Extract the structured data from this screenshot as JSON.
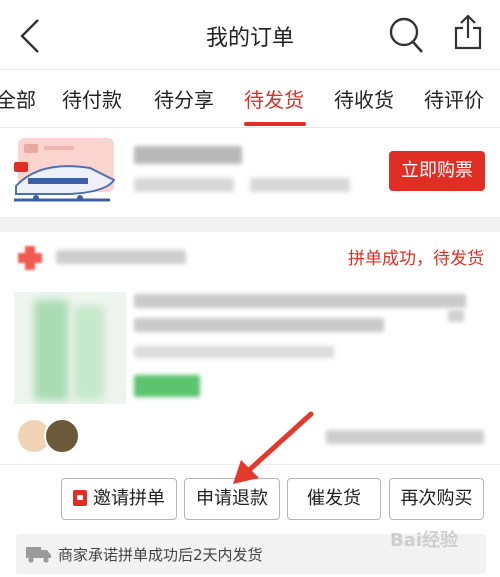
{
  "header": {
    "title": "我的订单",
    "back_icon": "chevron-left-icon",
    "search_icon": "search-icon",
    "share_icon": "share-icon"
  },
  "tabs": [
    {
      "label": "全部"
    },
    {
      "label": "待付款"
    },
    {
      "label": "待分享"
    },
    {
      "label": "待发货",
      "active": true
    },
    {
      "label": "待收货"
    },
    {
      "label": "待评价"
    }
  ],
  "promo": {
    "button_label": "立即购票"
  },
  "order": {
    "status": "拼单成功，待发货",
    "buttons": {
      "invite": "邀请拼单",
      "refund": "申请退款",
      "remind": "催发货",
      "rebuy": "再次购买"
    },
    "notice": "商家承诺拼单成功后2天内发货"
  },
  "watermark": "Bai经验",
  "colors": {
    "accent": "#e02e24",
    "background": "#f2f2f2"
  }
}
